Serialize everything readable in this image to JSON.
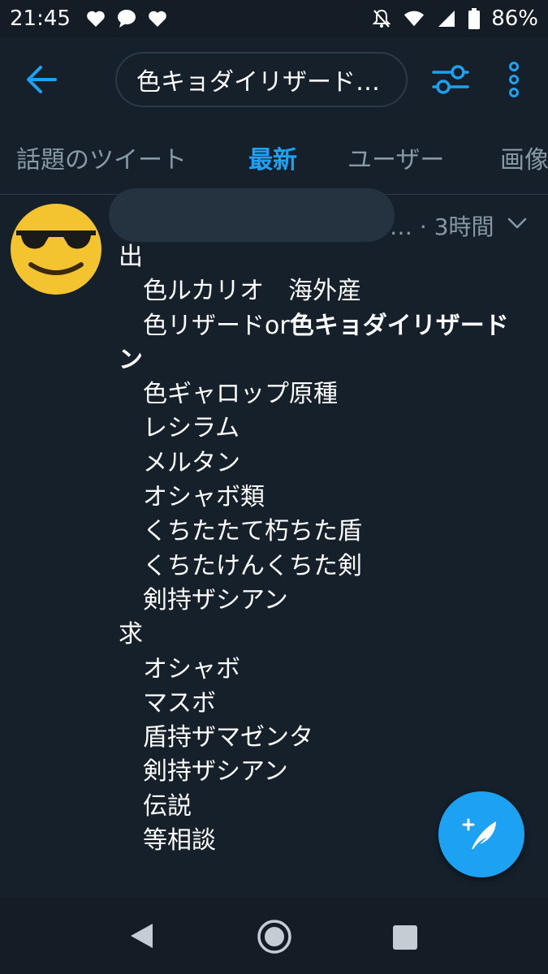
{
  "status_bar": {
    "time": "21:45",
    "battery": "86%",
    "left_icons": [
      "heart-icon",
      "chat-bubble-icon",
      "heart-icon"
    ],
    "right_icons": [
      "notifications-off-icon",
      "wifi-icon",
      "signal-icon",
      "battery-icon"
    ]
  },
  "header": {
    "search_text": "色キョダイリザード…"
  },
  "tabs": [
    {
      "label": "話題のツイート",
      "active": false
    },
    {
      "label": "最新",
      "active": true
    },
    {
      "label": "ユーザー",
      "active": false
    },
    {
      "label": "画像",
      "active": false
    }
  ],
  "tweet": {
    "meta": "… · 3時間",
    "lines": [
      {
        "text": "出"
      },
      {
        "text": "色ルカリオ　海外産"
      },
      {
        "pre": "色リザードor",
        "bold": "色キョダイリザード",
        "post": ""
      },
      {
        "text": "ン"
      },
      {
        "text": "色ギャロップ原種"
      },
      {
        "text": "レシラム"
      },
      {
        "text": "メルタン"
      },
      {
        "text": "オシャボ類"
      },
      {
        "text": "くちたたて朽ちた盾"
      },
      {
        "text": "くちたけんくちた剣"
      },
      {
        "text": "剣持ザシアン"
      },
      {
        "text": "求"
      },
      {
        "text": "オシャボ"
      },
      {
        "text": "マスボ"
      },
      {
        "text": "盾持ザマゼンタ"
      },
      {
        "text": "剣持ザシアン"
      },
      {
        "text": "伝説"
      },
      {
        "text": "等相談"
      }
    ]
  },
  "colors": {
    "background": "#15202b",
    "accent": "#1da1f2",
    "muted": "#8899a6"
  }
}
